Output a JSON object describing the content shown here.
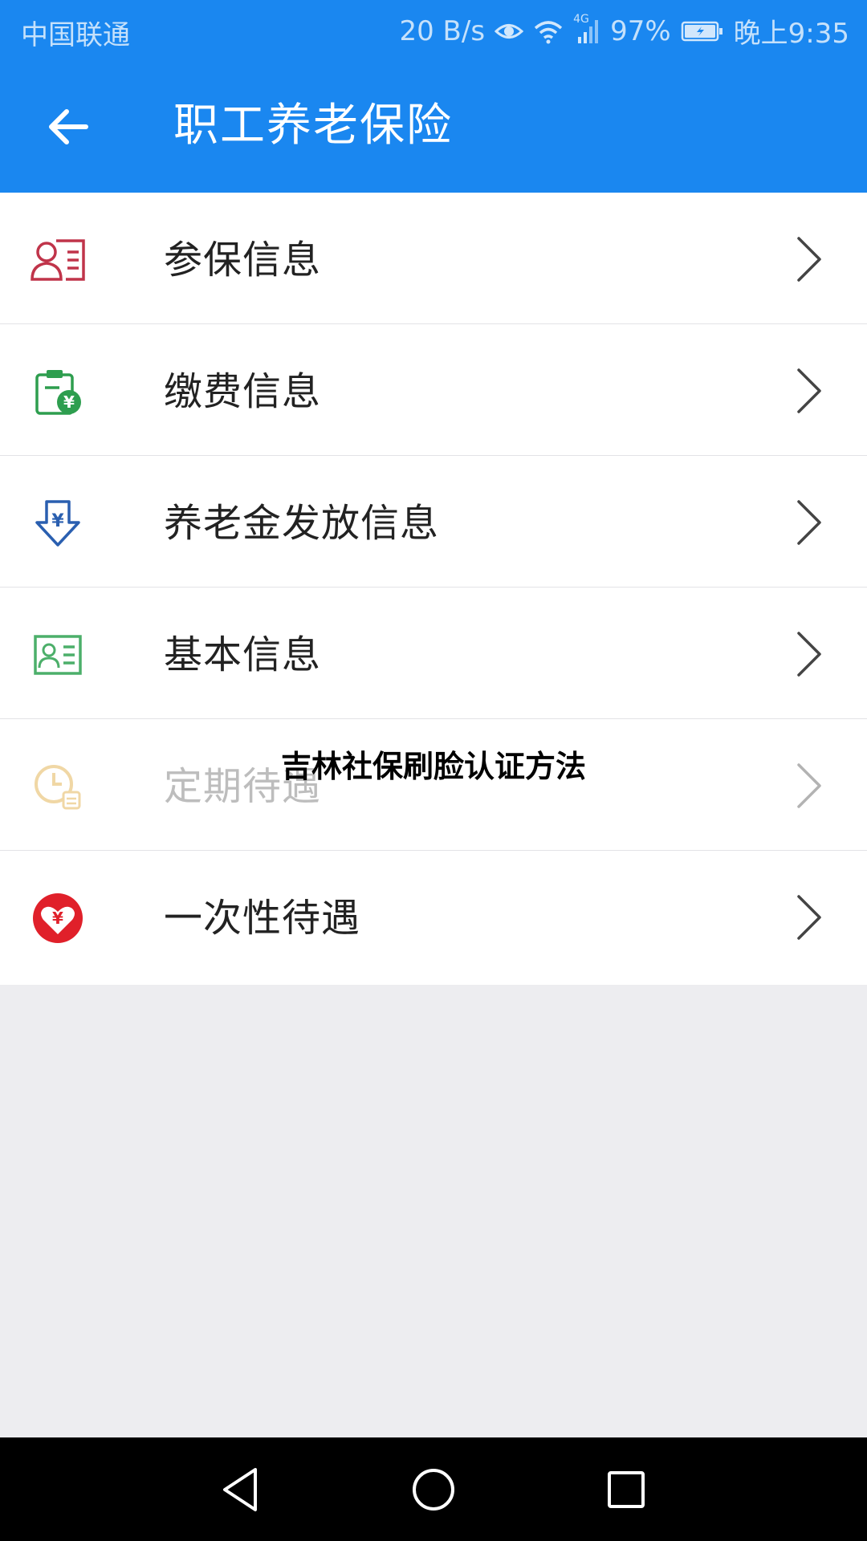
{
  "status_bar": {
    "carrier": "中国联通",
    "net_speed": "20 B/s",
    "network_type": "4G",
    "battery": "97%",
    "time": "晚上9:35"
  },
  "app_bar": {
    "title": "职工养老保险",
    "back_icon": "arrow-left-icon"
  },
  "menu": [
    {
      "label": "参保信息",
      "icon": "person-card-icon",
      "icon_color": "#c0344a"
    },
    {
      "label": "缴费信息",
      "icon": "clipboard-yen-icon",
      "icon_color": "#2e9e4f"
    },
    {
      "label": "养老金发放信息",
      "icon": "yen-download-icon",
      "icon_color": "#2a5fb0"
    },
    {
      "label": "基本信息",
      "icon": "id-card-icon",
      "icon_color": "#4caf6a"
    },
    {
      "label": "定期待遇",
      "icon": "clock-calendar-icon",
      "icon_color": "#e0a83a"
    },
    {
      "label": "一次性待遇",
      "icon": "heart-yen-icon",
      "icon_color": "#e0202a"
    }
  ],
  "overlay_caption": "吉林社保刷脸认证方法",
  "colors": {
    "header_blue": "#1a87f0",
    "background": "#ededf0"
  }
}
